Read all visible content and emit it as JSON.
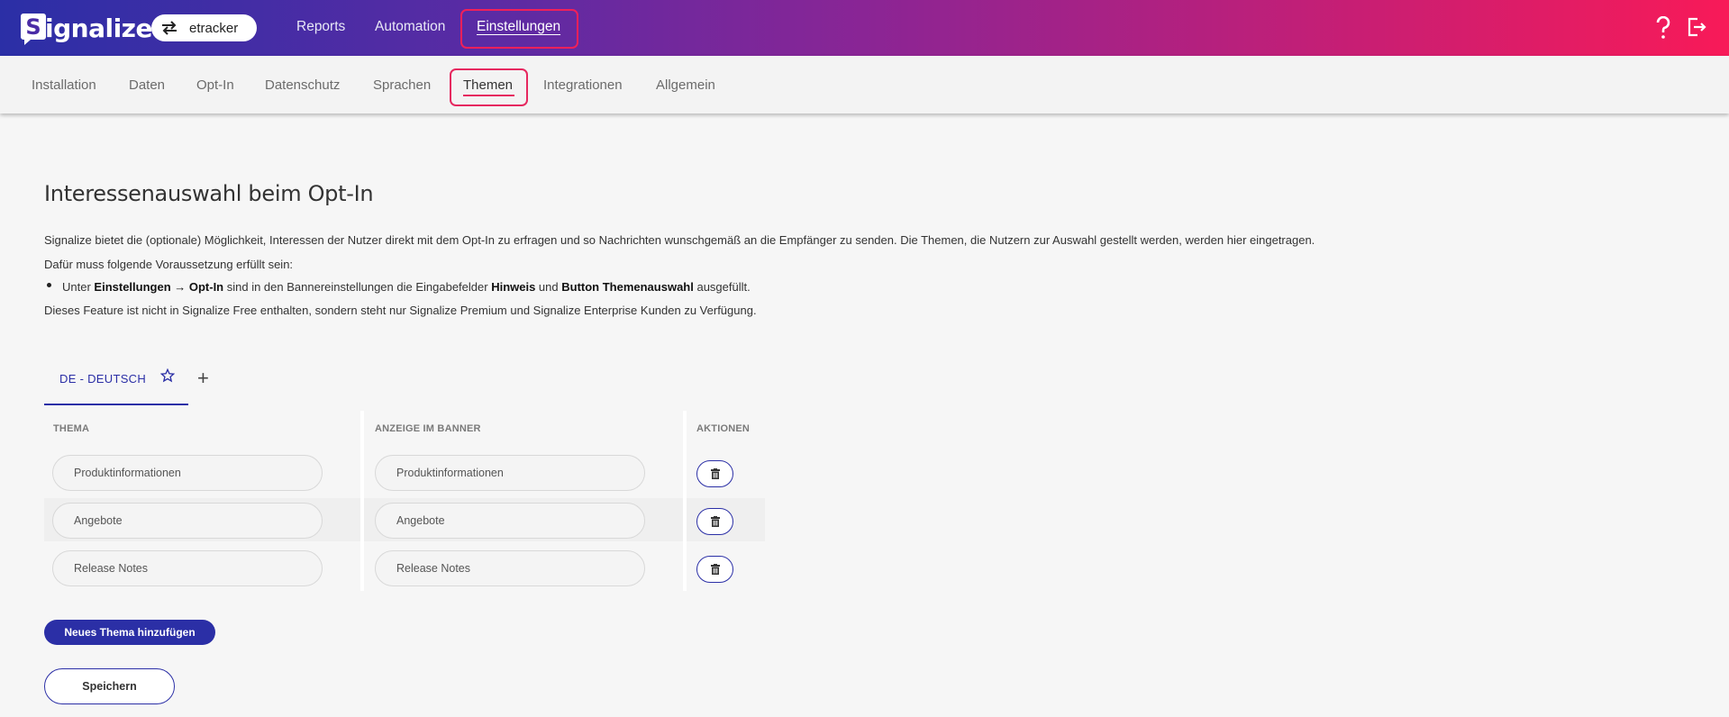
{
  "header": {
    "logo_text": "ignalize",
    "account_name": "etracker",
    "nav": [
      {
        "label": "Reports"
      },
      {
        "label": "Automation"
      },
      {
        "label": "Einstellungen",
        "active": true
      }
    ],
    "help_icon": "help-icon",
    "logout_icon": "logout-icon"
  },
  "subnav": {
    "items": [
      "Installation",
      "Daten",
      "Opt-In",
      "Datenschutz",
      "Sprachen",
      "Themen",
      "Integrationen",
      "Allgemein"
    ],
    "active": "Themen"
  },
  "main": {
    "title": "Interessenauswahl beim Opt-In",
    "intro": "Signalize bietet die (optionale) Möglichkeit, Interessen der Nutzer direkt mit dem Opt-In zu erfragen und so Nachrichten wunschgemäß an die Empfänger zu senden. Die Themen, die Nutzern zur Auswahl gestellt werden, werden hier eingetragen.",
    "requirement_intro": "Dafür muss folgende Voraussetzung erfüllt sein:",
    "bullet": {
      "t1": "Unter ",
      "b1": "Einstellungen → Opt-In",
      "t2": " sind in den Bannereinstellungen die Eingabefelder ",
      "b2": "Hinweis",
      "t3": " und ",
      "b3": "Button Themenauswahl",
      "t4": " ausgefüllt."
    },
    "feature_note": "Dieses Feature ist nicht in Signalize Free enthalten, sondern steht nur Signalize Premium und Signalize Enterprise Kunden zu Verfügung.",
    "language_tab": "DE - DEUTSCH",
    "table": {
      "headers": [
        "THEMA",
        "ANZEIGE IM BANNER",
        "AKTIONEN"
      ],
      "rows": [
        {
          "thema": "Produktinformationen",
          "anzeige": "Produktinformationen"
        },
        {
          "thema": "Angebote",
          "anzeige": "Angebote"
        },
        {
          "thema": "Release Notes",
          "anzeige": "Release Notes"
        }
      ]
    },
    "add_button": "Neues Thema hinzufügen",
    "save_button": "Speichern"
  },
  "colors": {
    "gradient_start": "#2b2fa6",
    "gradient_end": "#f81a58",
    "accent": "#2b2fa6",
    "highlight": "#e6285f"
  }
}
